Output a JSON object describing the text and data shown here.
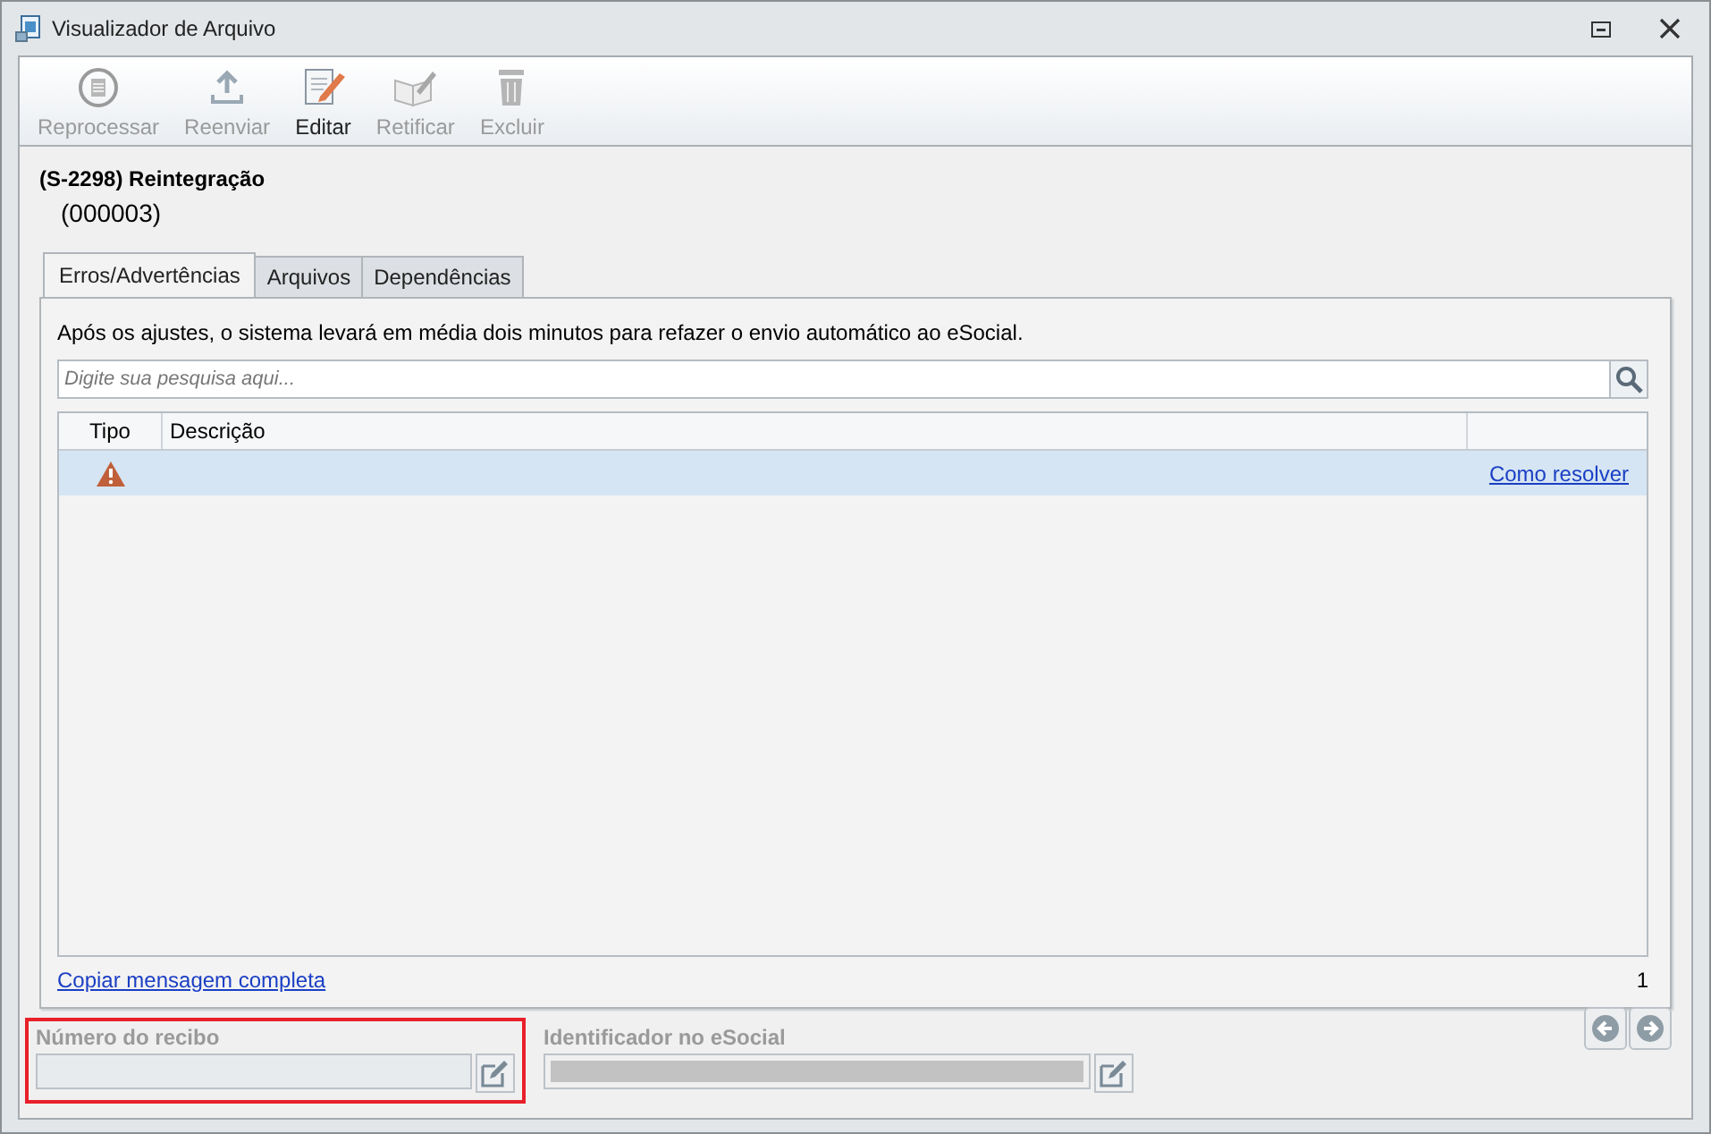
{
  "window": {
    "title": "Visualizador de Arquivo"
  },
  "toolbar": [
    {
      "label": "Reprocessar",
      "kind": "reprocess",
      "disabled": true
    },
    {
      "label": "Reenviar",
      "kind": "upload",
      "disabled": true
    },
    {
      "label": "Editar",
      "kind": "edit",
      "disabled": false
    },
    {
      "label": "Retificar",
      "kind": "rectify",
      "disabled": true
    },
    {
      "label": "Excluir",
      "kind": "delete",
      "disabled": true
    }
  ],
  "event": {
    "title": "(S-2298) Reintegração",
    "code": "(000003)"
  },
  "tabs": [
    {
      "label": "Erros/Advertências",
      "selected": true
    },
    {
      "label": "Arquivos",
      "selected": false
    },
    {
      "label": "Dependências",
      "selected": false
    }
  ],
  "message": "Após os ajustes, o sistema levará em média dois minutos para refazer o envio automático ao eSocial.",
  "search": {
    "placeholder": "Digite sua pesquisa aqui..."
  },
  "table": {
    "columns": [
      "Tipo",
      "Descrição"
    ],
    "rows": [
      {
        "kind": "warning",
        "link": "Como resolver",
        "selected": true
      }
    ]
  },
  "copy_link": "Copiar mensagem completa",
  "count": "1",
  "fields": [
    {
      "label": "Número do recibo",
      "filled": false,
      "highlighted": true
    },
    {
      "label": "Identificador no eSocial",
      "filled": true,
      "highlighted": false
    }
  ]
}
